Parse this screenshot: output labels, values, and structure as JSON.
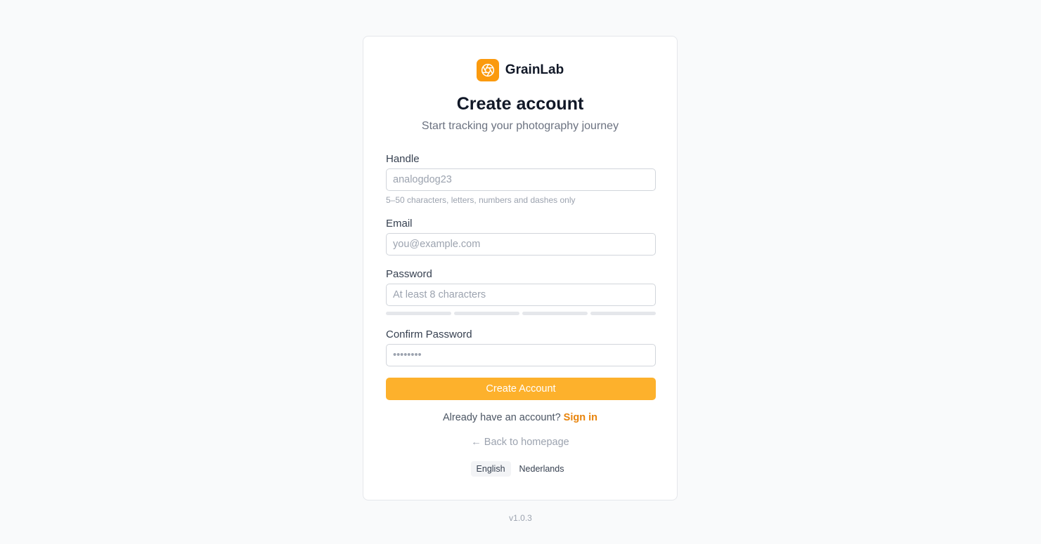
{
  "brand": {
    "name": "GrainLab",
    "logo_icon": "camera-aperture-icon",
    "accent_color": "#fb9a0e"
  },
  "heading": {
    "title": "Create account",
    "subtitle": "Start tracking your photography journey"
  },
  "form": {
    "handle": {
      "label": "Handle",
      "placeholder": "analogdog23",
      "value": "",
      "hint": "5–50 characters, letters, numbers and dashes only"
    },
    "email": {
      "label": "Email",
      "placeholder": "you@example.com",
      "value": ""
    },
    "password": {
      "label": "Password",
      "placeholder": "At least 8 characters",
      "value": "",
      "strength_segments": 4,
      "strength_filled": 0
    },
    "confirm_password": {
      "label": "Confirm Password",
      "placeholder": "••••••••",
      "value": ""
    },
    "submit_label": "Create Account"
  },
  "signin": {
    "prompt": "Already have an account?",
    "link_label": "Sign in"
  },
  "back_link": "← Back to homepage",
  "languages": {
    "items": [
      "English",
      "Nederlands"
    ],
    "selected": "English"
  },
  "version": "v1.0.3"
}
